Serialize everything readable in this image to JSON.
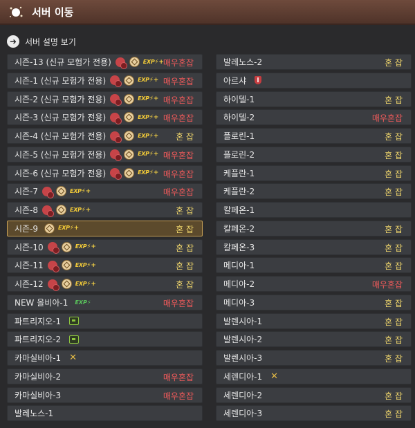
{
  "window": {
    "title": "서버 이동"
  },
  "desc_link": {
    "label": "서버 설명 보기"
  },
  "status_colors": {
    "normal": "#f0d66c",
    "busy": "#ef5a5a"
  },
  "servers_left": [
    {
      "name": "시즌-13 (신규 모험가 전용)",
      "status": "매우혼잡",
      "status_type": "busy",
      "icons": [
        "red",
        "gold",
        "exp"
      ]
    },
    {
      "name": "시즌-1 (신규 모험가 전용)",
      "status": "매우혼잡",
      "status_type": "busy",
      "icons": [
        "red",
        "gold",
        "exp"
      ]
    },
    {
      "name": "시즌-2 (신규 모험가 전용)",
      "status": "매우혼잡",
      "status_type": "busy",
      "icons": [
        "red",
        "gold",
        "exp"
      ]
    },
    {
      "name": "시즌-3 (신규 모험가 전용)",
      "status": "매우혼잡",
      "status_type": "busy",
      "icons": [
        "red",
        "gold",
        "exp"
      ]
    },
    {
      "name": "시즌-4 (신규 모험가 전용)",
      "status": "혼 잡",
      "status_type": "normal",
      "icons": [
        "red",
        "gold",
        "exp"
      ]
    },
    {
      "name": "시즌-5 (신규 모험가 전용)",
      "status": "매우혼잡",
      "status_type": "busy",
      "icons": [
        "red",
        "gold",
        "exp"
      ]
    },
    {
      "name": "시즌-6 (신규 모험가 전용)",
      "status": "매우혼잡",
      "status_type": "busy",
      "icons": [
        "red",
        "gold",
        "exp"
      ]
    },
    {
      "name": "시즌-7",
      "status": "매우혼잡",
      "status_type": "busy",
      "icons": [
        "red",
        "gold",
        "exp"
      ]
    },
    {
      "name": "시즌-8",
      "status": "혼 잡",
      "status_type": "normal",
      "icons": [
        "red",
        "gold",
        "exp"
      ]
    },
    {
      "name": "시즌-9",
      "status": "혼 잡",
      "status_type": "normal",
      "icons": [
        "gold",
        "exp"
      ],
      "selected": true
    },
    {
      "name": "시즌-10",
      "status": "혼 잡",
      "status_type": "normal",
      "icons": [
        "red",
        "gold",
        "exp"
      ]
    },
    {
      "name": "시즌-11",
      "status": "혼 잡",
      "status_type": "normal",
      "icons": [
        "red",
        "gold",
        "exp"
      ]
    },
    {
      "name": "시즌-12",
      "status": "혼 잡",
      "status_type": "normal",
      "icons": [
        "red",
        "gold",
        "exp"
      ]
    },
    {
      "name": "NEW 올비아-1",
      "status": "매우혼잡",
      "status_type": "busy",
      "icons": [
        "exp-green"
      ]
    },
    {
      "name": "파트리지오-1",
      "status": "",
      "status_type": "normal",
      "icons": [
        "pc"
      ]
    },
    {
      "name": "파트리지오-2",
      "status": "",
      "status_type": "normal",
      "icons": [
        "pc"
      ]
    },
    {
      "name": "카마실비아-1",
      "status": "",
      "status_type": "normal",
      "icons": [
        "swords"
      ]
    },
    {
      "name": "카마실비아-2",
      "status": "매우혼잡",
      "status_type": "busy",
      "icons": []
    },
    {
      "name": "카마실비아-3",
      "status": "매우혼잡",
      "status_type": "busy",
      "icons": []
    },
    {
      "name": "발레노스-1",
      "status": "",
      "status_type": "normal",
      "icons": []
    }
  ],
  "servers_right": [
    {
      "name": "발레노스-2",
      "status": "혼 잡",
      "status_type": "normal",
      "icons": []
    },
    {
      "name": "아르샤",
      "status": "",
      "status_type": "normal",
      "icons": [
        "shield"
      ]
    },
    {
      "name": "하이델-1",
      "status": "혼 잡",
      "status_type": "normal",
      "icons": []
    },
    {
      "name": "하이델-2",
      "status": "매우혼잡",
      "status_type": "busy",
      "icons": []
    },
    {
      "name": "플로린-1",
      "status": "혼 잡",
      "status_type": "normal",
      "icons": []
    },
    {
      "name": "플로린-2",
      "status": "혼 잡",
      "status_type": "normal",
      "icons": []
    },
    {
      "name": "케플란-1",
      "status": "혼 잡",
      "status_type": "normal",
      "icons": []
    },
    {
      "name": "케플란-2",
      "status": "혼 잡",
      "status_type": "normal",
      "icons": []
    },
    {
      "name": "칼페온-1",
      "status": "",
      "status_type": "normal",
      "icons": []
    },
    {
      "name": "칼페온-2",
      "status": "혼 잡",
      "status_type": "normal",
      "icons": []
    },
    {
      "name": "칼페온-3",
      "status": "혼 잡",
      "status_type": "normal",
      "icons": []
    },
    {
      "name": "메디아-1",
      "status": "혼 잡",
      "status_type": "normal",
      "icons": []
    },
    {
      "name": "메디아-2",
      "status": "매우혼잡",
      "status_type": "busy",
      "icons": []
    },
    {
      "name": "메디아-3",
      "status": "혼 잡",
      "status_type": "normal",
      "icons": []
    },
    {
      "name": "발렌시아-1",
      "status": "혼 잡",
      "status_type": "normal",
      "icons": []
    },
    {
      "name": "발렌시아-2",
      "status": "혼 잡",
      "status_type": "normal",
      "icons": []
    },
    {
      "name": "발렌시아-3",
      "status": "혼 잡",
      "status_type": "normal",
      "icons": []
    },
    {
      "name": "세렌디아-1",
      "status": "",
      "status_type": "normal",
      "icons": [
        "swords"
      ]
    },
    {
      "name": "세렌디아-2",
      "status": "혼 잡",
      "status_type": "normal",
      "icons": []
    },
    {
      "name": "세렌디아-3",
      "status": "혼 잡",
      "status_type": "normal",
      "icons": []
    }
  ]
}
